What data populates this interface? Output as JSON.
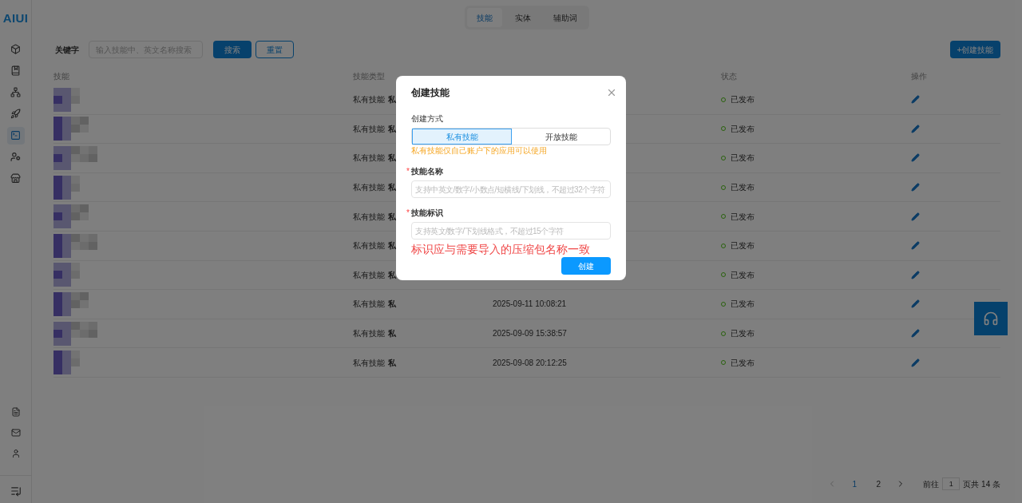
{
  "logo": "AIUI",
  "sidebar": {
    "items": [
      {
        "selected": false
      },
      {
        "selected": false
      },
      {
        "selected": false
      },
      {
        "selected": false
      },
      {
        "selected": true
      },
      {
        "selected": false
      },
      {
        "selected": false
      }
    ],
    "bottom_items": [
      {
        "selected": false
      },
      {
        "selected": false
      },
      {
        "selected": false
      }
    ]
  },
  "tabs": [
    {
      "label": "技能",
      "selected": true
    },
    {
      "label": "实体",
      "selected": false
    },
    {
      "label": "辅助词",
      "selected": false
    }
  ],
  "filter": {
    "label": "关键字",
    "placeholder": "输入技能中、英文名称搜索",
    "search_button": "搜索",
    "reset_button": "重置"
  },
  "create_button": "+创建技能",
  "table": {
    "columns": [
      "技能",
      "技能类型",
      "状态",
      "操作"
    ],
    "rows": [
      {
        "type": "私有技能",
        "badge": "私",
        "status": "已发布"
      },
      {
        "type": "私有技能",
        "badge": "私",
        "status": "已发布"
      },
      {
        "type": "私有技能",
        "badge": "私",
        "status": "已发布"
      },
      {
        "type": "私有技能",
        "badge": "私",
        "status": "已发布"
      },
      {
        "type": "私有技能",
        "badge": "私",
        "status": "已发布"
      },
      {
        "type": "私有技能",
        "badge": "私",
        "status": "已发布"
      },
      {
        "type": "私有技能",
        "badge": "私",
        "status": "已发布"
      },
      {
        "type": "私有技能",
        "badge": "私",
        "time": "2025-09-11 10:08:21",
        "status": "已发布"
      },
      {
        "type": "私有技能",
        "badge": "私",
        "time": "2025-09-09 15:38:57",
        "status": "已发布"
      },
      {
        "type": "私有技能",
        "badge": "私",
        "time": "2025-09-08 20:12:25",
        "status": "已发布"
      }
    ]
  },
  "pagination": {
    "pages": [
      {
        "label": "1",
        "selected": true
      },
      {
        "label": "2",
        "selected": false
      }
    ],
    "goto_label": "前往",
    "goto_value": "1",
    "total": "页共 14 条"
  },
  "dialog": {
    "title": "创建技能",
    "method_label": "创建方式",
    "methods": [
      {
        "label": "私有技能",
        "selected": true
      },
      {
        "label": "开放技能",
        "selected": false
      }
    ],
    "method_hint": "私有技能仅自己账户下的应用可以使用",
    "fields": [
      {
        "label": "技能名称",
        "required_mark": "*",
        "placeholder": "支持中英文/数字/小数点/短横线/下划线，不超过32个字符"
      },
      {
        "label": "技能标识",
        "required_mark": "*",
        "placeholder": "支持英文/数字/下划线格式，不超过15个字符"
      }
    ],
    "annotation": "标识应与需要导入的压缩包名称一致",
    "submit": "创建"
  }
}
